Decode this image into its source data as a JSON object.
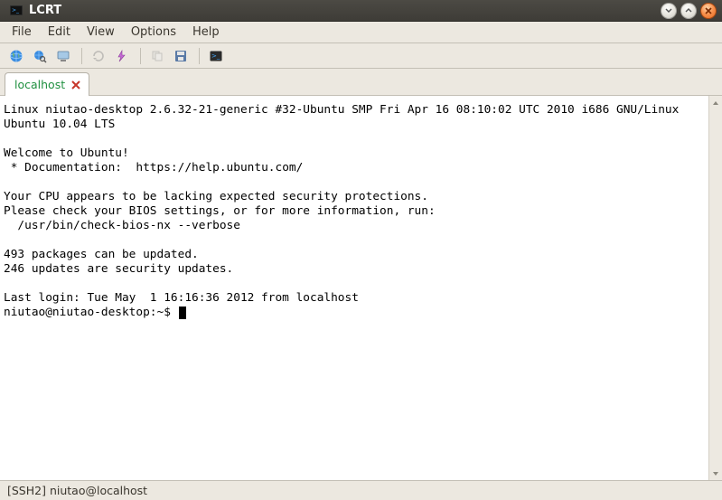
{
  "title": "LCRT",
  "menu": {
    "file": "File",
    "edit": "Edit",
    "view": "View",
    "options": "Options",
    "help": "Help"
  },
  "tab": {
    "label": "localhost"
  },
  "terminal": {
    "lines": "Linux niutao-desktop 2.6.32-21-generic #32-Ubuntu SMP Fri Apr 16 08:10:02 UTC 2010 i686 GNU/Linux\nUbuntu 10.04 LTS\n\nWelcome to Ubuntu!\n * Documentation:  https://help.ubuntu.com/\n\nYour CPU appears to be lacking expected security protections.\nPlease check your BIOS settings, or for more information, run:\n  /usr/bin/check-bios-nx --verbose\n\n493 packages can be updated.\n246 updates are security updates.\n\nLast login: Tue May  1 16:16:36 2012 from localhost",
    "prompt": "niutao@niutao-desktop:~$ "
  },
  "status": "[SSH2] niutao@localhost"
}
